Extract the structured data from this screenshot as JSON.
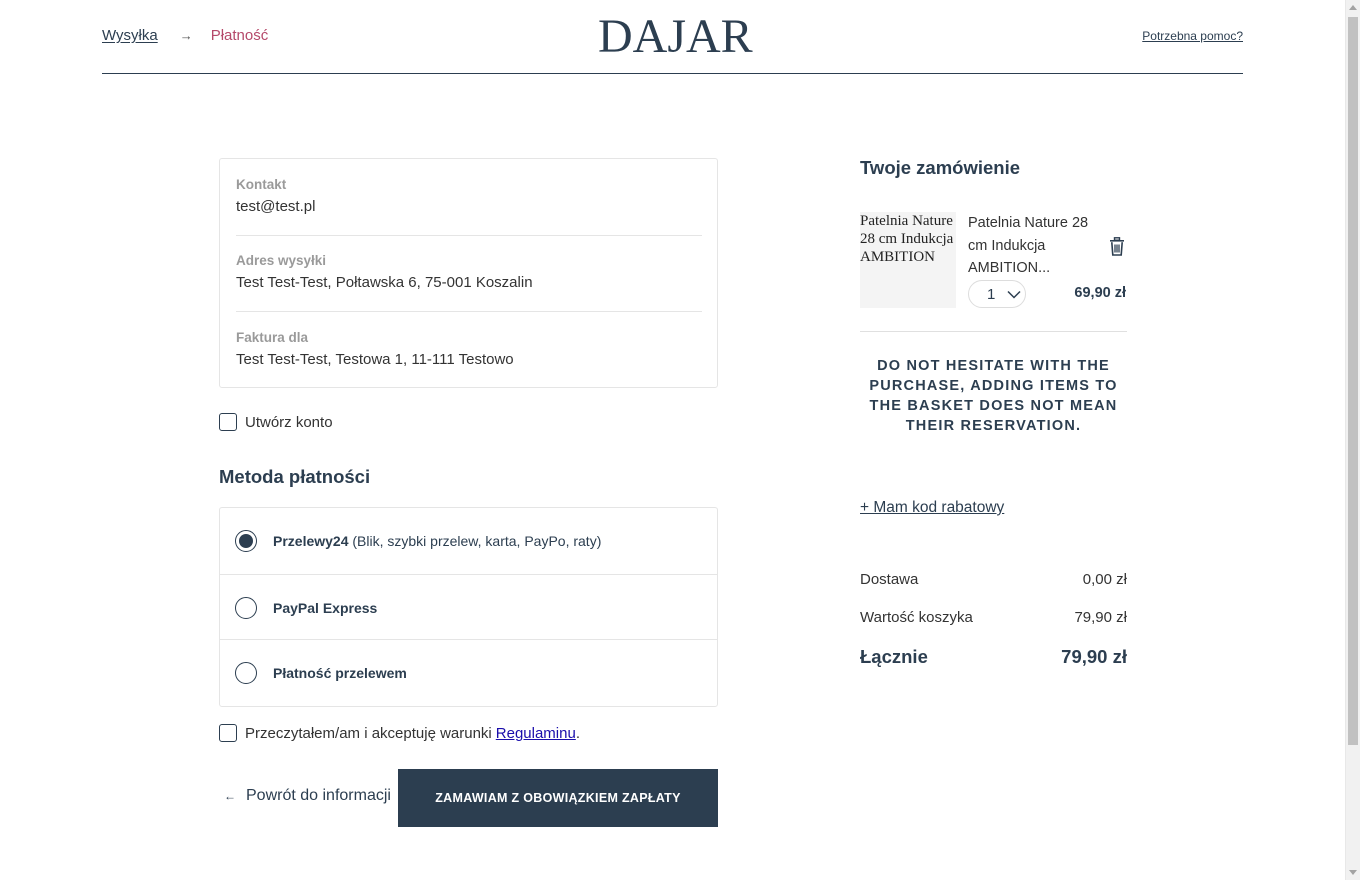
{
  "header": {
    "breadcrumb_shipping": "Wysyłka",
    "breadcrumb_arrow": "→",
    "breadcrumb_payment": "Płatność",
    "logo": "DAJAR",
    "help_link": "Potrzebna pomoc?"
  },
  "summary": {
    "contact_label": "Kontakt",
    "contact_value": "test@test.pl",
    "shipping_label": "Adres wysyłki",
    "shipping_value": "Test Test-Test, Połtawska 6, 75-001 Koszalin",
    "invoice_label": "Faktura dla",
    "invoice_value": "Test Test-Test, Testowa 1, 11-111 Testowo"
  },
  "create_account": {
    "label": "Utwórz konto",
    "checked": false
  },
  "payment": {
    "title": "Metoda płatności",
    "options": [
      {
        "name": "Przelewy24",
        "detail": " (Blik, szybki przelew, karta, PayPo, raty)",
        "selected": true
      },
      {
        "name": "PayPal Express",
        "detail": "",
        "selected": false
      },
      {
        "name": "Płatność przelewem",
        "detail": "",
        "selected": false
      }
    ]
  },
  "terms": {
    "text": "Przeczytałem/am i akceptuję warunki ",
    "link": "Regulaminu",
    "suffix": ".",
    "checked": false
  },
  "actions": {
    "back_arrow": "←",
    "back_label": "Powrót do informacji",
    "submit_label": "ZAMAWIAM Z OBOWIĄZKIEM ZAPŁATY"
  },
  "order": {
    "title": "Twoje zamówienie",
    "product": {
      "image_alt": "Patelnia Nature 28 cm Indukcja AMBITION",
      "name": "Patelnia Nature 28 cm Indukcja AMBITION...",
      "quantity": "1",
      "price": "69,90 zł"
    },
    "notice": "DO NOT HESITATE WITH THE PURCHASE, ADDING ITEMS TO THE BASKET DOES NOT MEAN THEIR RESERVATION.",
    "promo_link": "+ Mam kod rabatowy",
    "delivery_label": "Dostawa",
    "delivery_value": "0,00 zł",
    "cart_label": "Wartość koszyka",
    "cart_value": "79,90 zł",
    "total_label": "Łącznie",
    "total_value": "79,90 zł"
  },
  "colors": {
    "primary": "#2c3e50",
    "accent": "#b5496a",
    "border": "#e5e5e5"
  }
}
